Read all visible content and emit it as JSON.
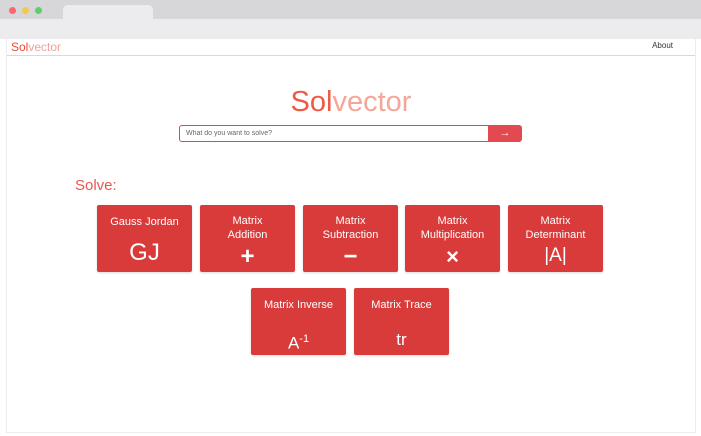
{
  "brand": {
    "part1": "Sol",
    "part2": "vector"
  },
  "nav": {
    "about": "About"
  },
  "hero": {
    "part1": "Sol",
    "part2": "vector"
  },
  "search": {
    "placeholder": "What do you want to solve?",
    "button_icon": "→"
  },
  "solve_label": "Solve:",
  "cards_row1": [
    {
      "name": "Gauss Jordan",
      "symbol": "GJ"
    },
    {
      "name_line1": "Matrix",
      "name_line2": "Addition",
      "symbol": "+"
    },
    {
      "name_line1": "Matrix",
      "name_line2": "Subtraction",
      "symbol": "−"
    },
    {
      "name_line1": "Matrix",
      "name_line2": "Multiplication",
      "symbol": "×"
    },
    {
      "name_line1": "Matrix",
      "name_line2": "Determinant",
      "symbol": "|A|"
    }
  ],
  "cards_row2": [
    {
      "name": "Matrix Inverse",
      "symbol_base": "A",
      "symbol_sup": "-1"
    },
    {
      "name": "Matrix Trace",
      "symbol": "tr"
    }
  ]
}
